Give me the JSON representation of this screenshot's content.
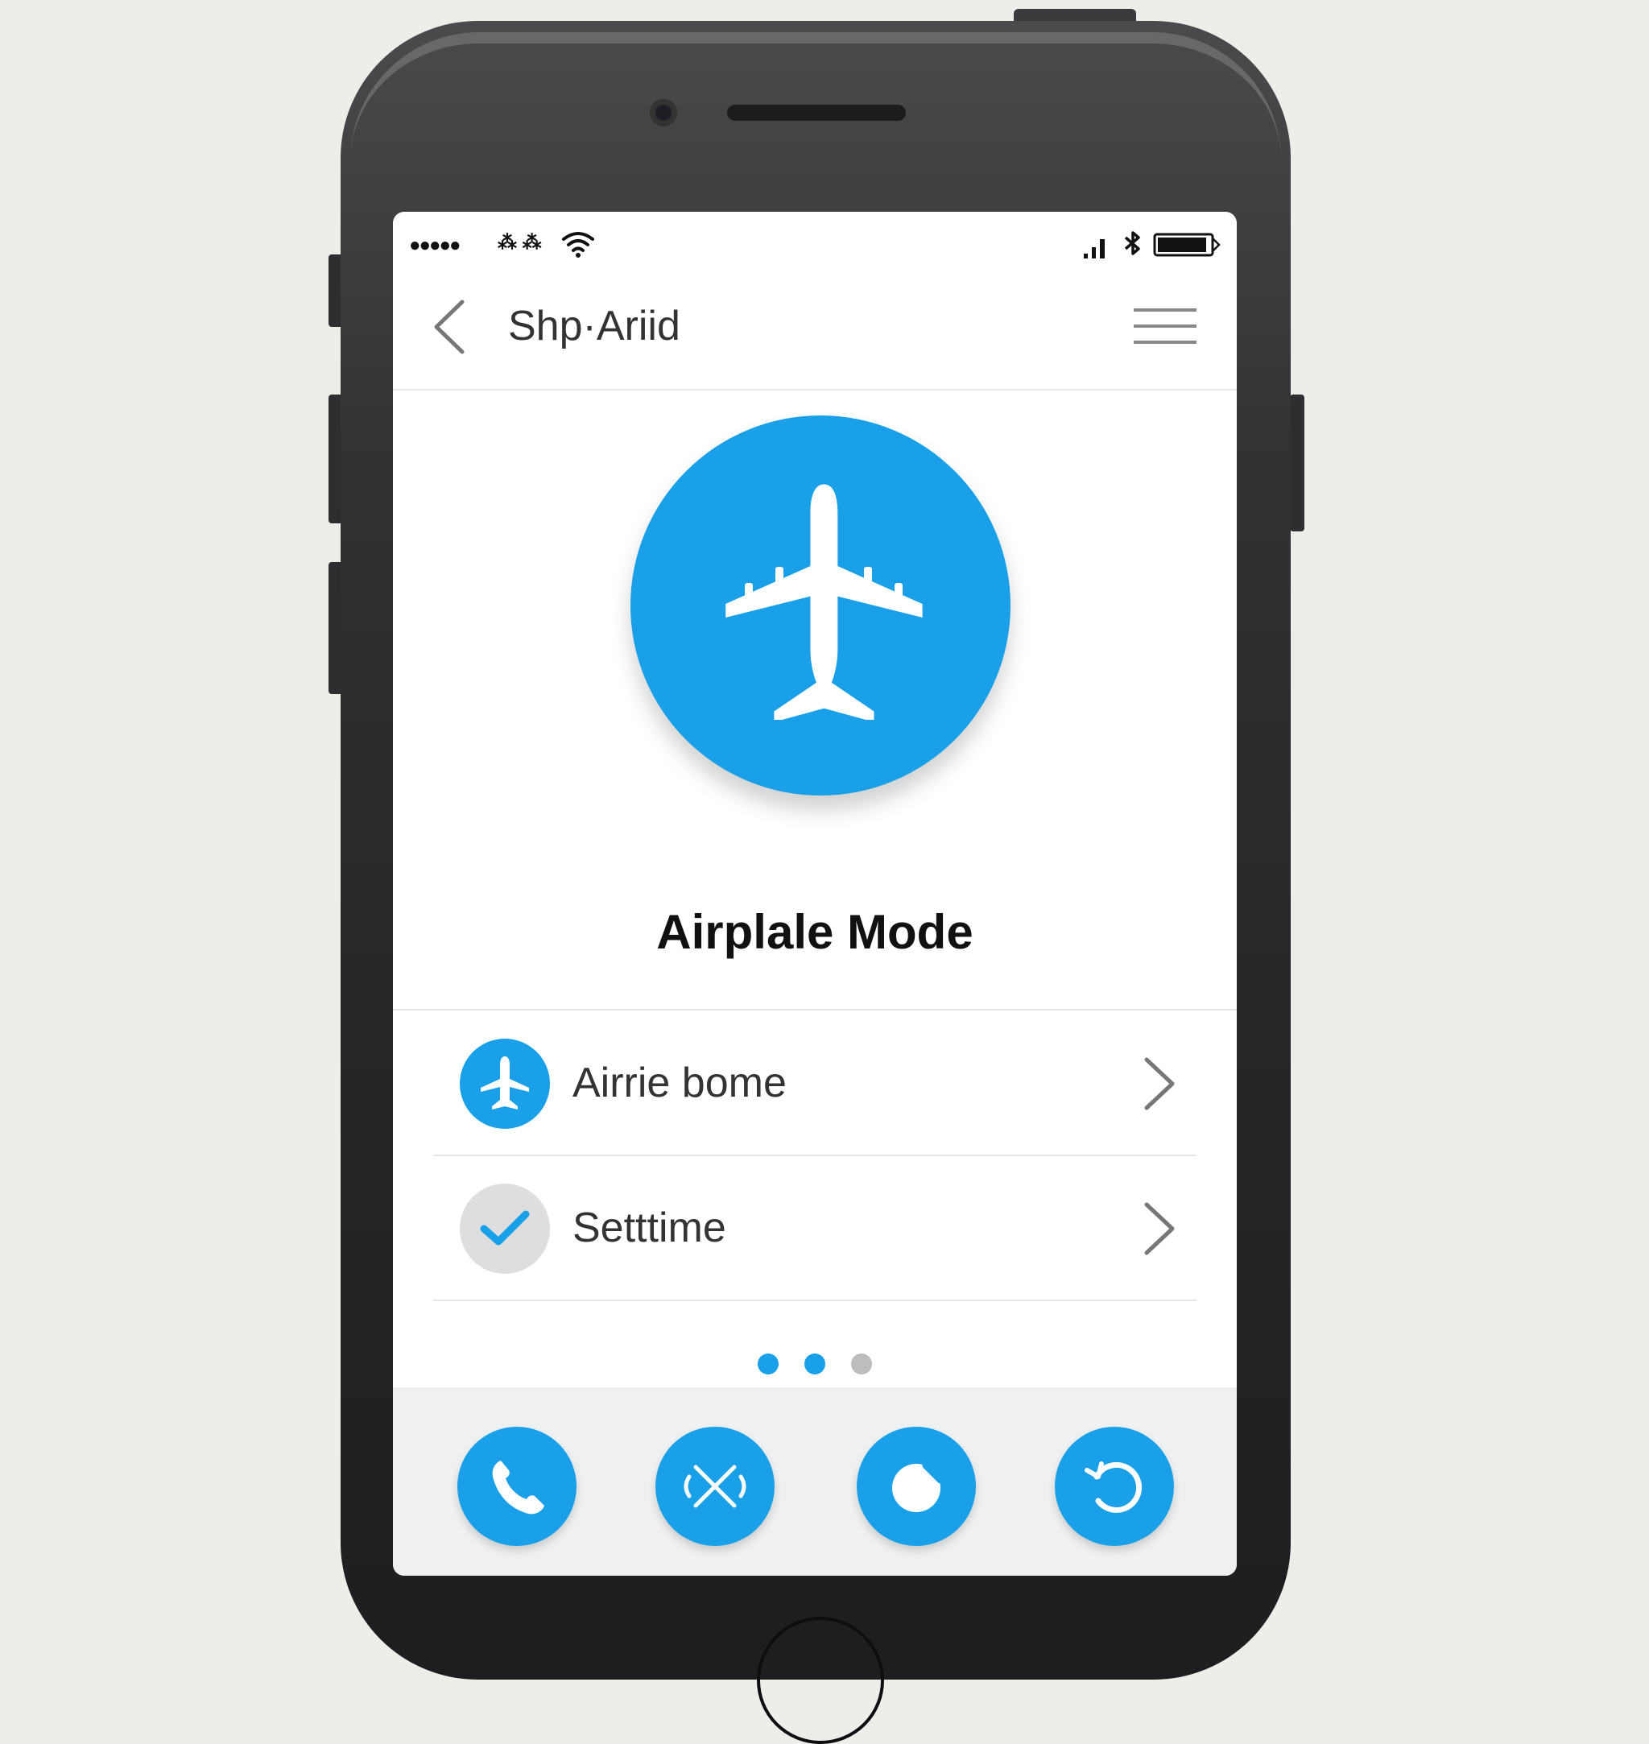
{
  "status_bar": {
    "signal_dots": "●●●●●",
    "carrier_glyphs": "⁂ ⁂",
    "icons": [
      "wifi-icon",
      "cellular-signal-icon",
      "bluetooth-icon",
      "battery-icon"
    ]
  },
  "nav": {
    "title": "Shp·Ariid",
    "back_icon": "chevron-left-icon",
    "menu_icon": "hamburger-menu-icon"
  },
  "hero": {
    "icon": "airplane-icon",
    "title": "Airplale Mode"
  },
  "list": [
    {
      "label": "Airrie bome",
      "icon": "airplane-icon",
      "icon_bg": "#1aa0e8"
    },
    {
      "label": "Setttime",
      "icon": "checkmark-icon",
      "icon_bg": "#dedede"
    }
  ],
  "page_indicator": {
    "count": 3,
    "active": [
      0,
      1
    ]
  },
  "actions": [
    {
      "name": "phone-icon"
    },
    {
      "name": "airplane-off-icon"
    },
    {
      "name": "toggle-icon"
    },
    {
      "name": "refresh-icon"
    }
  ],
  "colors": {
    "accent": "#1aa0e8",
    "inactive_dot": "#bdbdbd",
    "bottom_bar": "#eef0f1"
  }
}
